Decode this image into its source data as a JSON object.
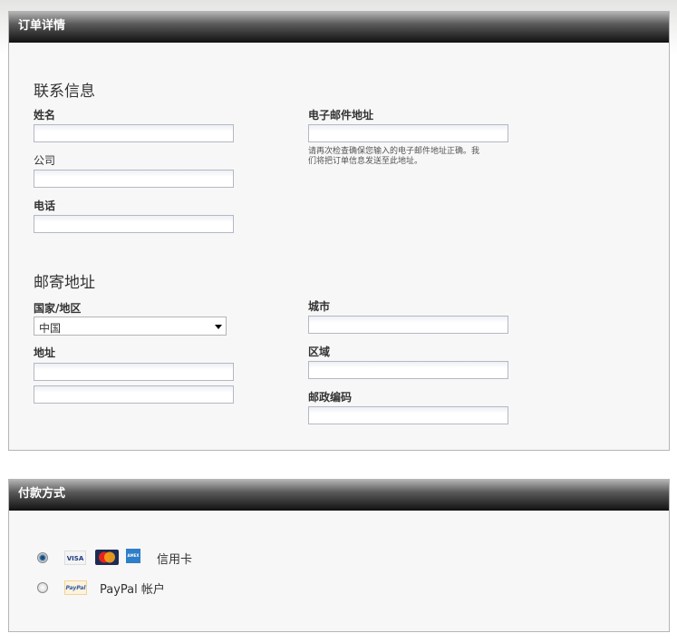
{
  "order": {
    "title": "订单详情",
    "contact": {
      "heading": "联系信息",
      "name_label": "姓名",
      "company_label": "公司",
      "phone_label": "电话",
      "email_label": "电子邮件地址",
      "email_hint": "请再次检查确保您输入的电子邮件地址正确。我们将把订单信息发送至此地址。"
    },
    "shipping": {
      "heading": "邮寄地址",
      "country_label": "国家/地区",
      "country_value": "中国",
      "address_label": "地址",
      "city_label": "城市",
      "region_label": "区域",
      "postal_label": "邮政编码"
    }
  },
  "payment": {
    "title": "付款方式",
    "options": [
      {
        "label": "信用卡",
        "selected": true,
        "icons": [
          "visa-icon",
          "mastercard-icon",
          "amex-icon"
        ],
        "icon_text": [
          "VISA",
          "MasterCard",
          "AMEX"
        ]
      },
      {
        "label": "PayPal 帐户",
        "selected": false,
        "icons": [
          "paypal-icon"
        ],
        "icon_text": [
          "PayPal"
        ]
      }
    ]
  }
}
